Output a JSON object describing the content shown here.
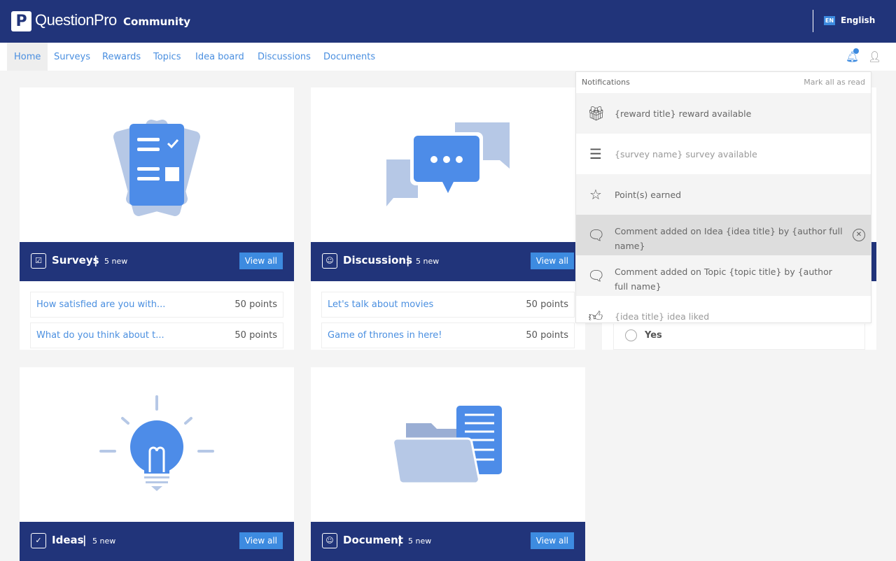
{
  "header": {
    "logo_letter": "P",
    "brand": "QuestionPro",
    "product": "Community",
    "lang_code": "EN",
    "lang": "English"
  },
  "nav": [
    {
      "label": "Home",
      "active": true
    },
    {
      "label": "Surveys"
    },
    {
      "label": "Rewards"
    },
    {
      "label": "Topics"
    },
    {
      "label": "Idea board"
    },
    {
      "label": "Discussions"
    },
    {
      "label": "Documents"
    }
  ],
  "cards": [
    {
      "title": "Surveys",
      "count": "5 new",
      "view_all": "View all",
      "rows": [
        {
          "q": "How satisfied are you with...",
          "p": "50 points"
        },
        {
          "q": "What do you think about t...",
          "p": "50 points"
        }
      ]
    },
    {
      "title": "Discussions",
      "count": "5 new",
      "view_all": "View all",
      "rows": [
        {
          "q": "Let's talk about movies",
          "p": "50 points"
        },
        {
          "q": "Game of thrones in here!",
          "p": "50 points"
        }
      ]
    },
    {
      "title": "Ideas",
      "count": "5 new",
      "view_all": "View all"
    },
    {
      "title": "Document",
      "count": "5 new",
      "view_all": "View all"
    }
  ],
  "poll": {
    "option": "Yes"
  },
  "notifications": {
    "title": "Notifications",
    "mark_all": "Mark all as read",
    "items": [
      {
        "icon": "gift-icon",
        "text": "{reward title} reward available",
        "state": "unread"
      },
      {
        "icon": "list-icon",
        "text": "{survey name} survey available",
        "state": "read"
      },
      {
        "icon": "star-icon",
        "text": "Point(s) earned",
        "state": "unread"
      },
      {
        "icon": "comment-icon",
        "text": "Comment added on Idea {idea title} by {author full name}",
        "state": "hover"
      },
      {
        "icon": "comment-icon",
        "text": "Comment added on Topic {topic title} by {author full name}",
        "state": "unread"
      },
      {
        "icon": "thumbs-up-icon",
        "text": "{idea title} idea liked",
        "state": "read"
      }
    ]
  },
  "colors": {
    "navy": "#21347a",
    "accent": "#3d8be0"
  }
}
